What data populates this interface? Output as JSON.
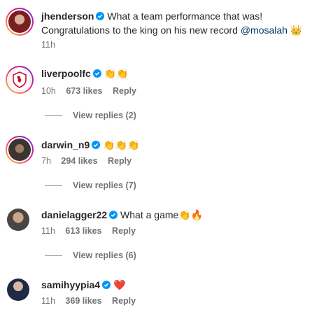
{
  "comments": [
    {
      "username": "jhenderson",
      "verified": true,
      "text_line1": "What a team performance that was!",
      "text_line2": "Congratulations to the king on his new record",
      "mention": "@mosalah",
      "emoji": "👑",
      "time": "11h"
    },
    {
      "username": "liverpoolfc",
      "verified": true,
      "emoji": "👏👏",
      "time": "10h",
      "likes": "673 likes",
      "reply": "Reply",
      "view_replies": "View replies (2)"
    },
    {
      "username": "darwin_n9",
      "verified": true,
      "emoji": "👏👏👏",
      "time": "7h",
      "likes": "294 likes",
      "reply": "Reply",
      "view_replies": "View replies (7)"
    },
    {
      "username": "danielagger22",
      "verified": true,
      "text": "What a game",
      "emoji": "👏🔥",
      "time": "11h",
      "likes": "613 likes",
      "reply": "Reply",
      "view_replies": "View replies (6)"
    },
    {
      "username": "samihyypia4",
      "verified": true,
      "emoji": "❤️",
      "time": "11h",
      "likes": "369 likes",
      "reply": "Reply"
    }
  ],
  "colors": {
    "verified_blue": "#0095f6",
    "liverpool_red": "#c8102e",
    "mention": "#00376b",
    "meta_gray": "#737373"
  }
}
